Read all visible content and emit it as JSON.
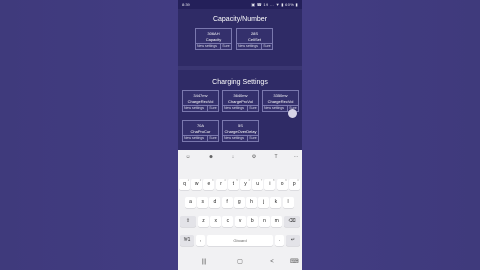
{
  "status_bar": {
    "time": "8:39",
    "icons": "▣ ☎ 19 … ▼ ▮ 60% ▮"
  },
  "capacity": {
    "title": "Capacity/Number",
    "cards": [
      {
        "value": "306AH",
        "label": "Capacity",
        "new": "New settings",
        "sure": "Sure"
      },
      {
        "value": "28S",
        "label": "CellSet",
        "new": "New settings",
        "sure": "Sure"
      }
    ]
  },
  "charging": {
    "title": "Charging Settings",
    "cards": [
      {
        "value": "3447mv",
        "label": "ChargeRecVol",
        "new": "New settings",
        "sure": "Sure"
      },
      {
        "value": "3640mv",
        "label": "ChargeProVol",
        "new": "New settings",
        "sure": "Sure"
      },
      {
        "value": "3350mv",
        "label": "ChargeRecVol",
        "new": "New settings",
        "sure": "Sure"
      },
      {
        "value": "70A",
        "label": "ChaProCur",
        "new": "New settings",
        "sure": "Sure"
      },
      {
        "value": "5S",
        "label": "ChargeOverDelay",
        "new": "New settings",
        "sure": "Sure"
      }
    ]
  },
  "keyboard": {
    "toolbar_icons": [
      "emoji-icon",
      "sticker-icon",
      "mic-icon",
      "gear-icon",
      "text-edit-icon",
      "more-icon"
    ],
    "toolbar_glyphs": [
      "☺",
      "☻",
      "↓",
      "⚙",
      "T",
      "···"
    ],
    "row_numbers": [
      "1",
      "2",
      "3",
      "4",
      "5",
      "6",
      "7",
      "8",
      "9",
      "0"
    ],
    "row1": [
      "q",
      "w",
      "e",
      "r",
      "t",
      "y",
      "u",
      "i",
      "o",
      "p"
    ],
    "row2": [
      "a",
      "s",
      "d",
      "f",
      "g",
      "h",
      "j",
      "k",
      "l"
    ],
    "row3": [
      "z",
      "x",
      "c",
      "v",
      "b",
      "n",
      "m"
    ],
    "shift": "⇧",
    "backspace": "⌫",
    "symbols": "!#1",
    "comma": ",",
    "space": "Gboard",
    "period": ".",
    "enter": "↵"
  },
  "navbar": {
    "recent": "|||",
    "home": "▢",
    "back": "<",
    "keyboard": "⌨"
  }
}
